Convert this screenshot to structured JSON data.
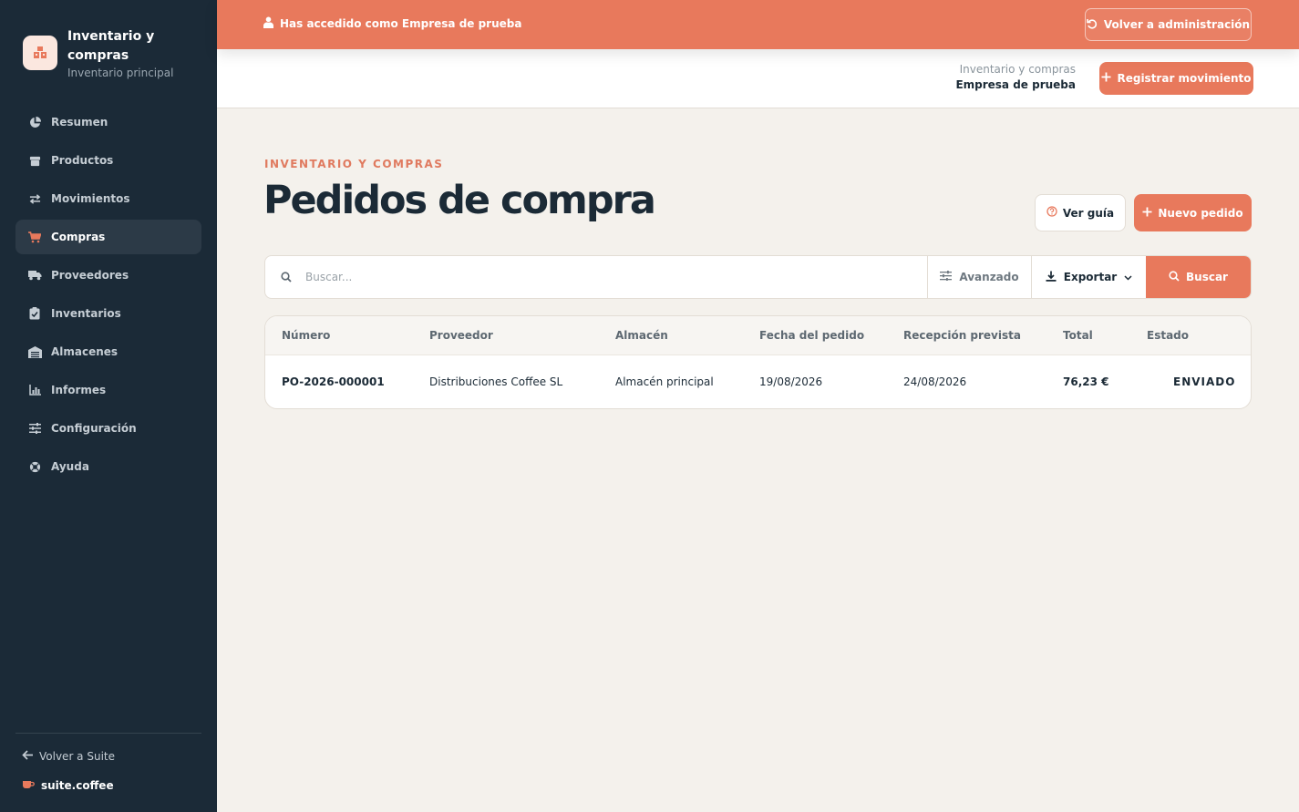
{
  "sidebar": {
    "app_title": "Inventario y compras",
    "app_subtitle": "Inventario principal",
    "items": [
      {
        "label": "Resumen",
        "icon": "pie-chart-icon"
      },
      {
        "label": "Productos",
        "icon": "box-icon"
      },
      {
        "label": "Movimientos",
        "icon": "arrows-exchange-icon"
      },
      {
        "label": "Compras",
        "icon": "cart-icon",
        "active": true
      },
      {
        "label": "Proveedores",
        "icon": "truck-icon"
      },
      {
        "label": "Inventarios",
        "icon": "clipboard-check-icon"
      },
      {
        "label": "Almacenes",
        "icon": "warehouse-icon"
      },
      {
        "label": "Informes",
        "icon": "bar-chart-icon"
      },
      {
        "label": "Configuración",
        "icon": "sliders-icon"
      },
      {
        "label": "Ayuda",
        "icon": "lifebuoy-icon"
      }
    ],
    "back_label": "Volver a Suite",
    "suite_brand": "suite.coffee"
  },
  "banner": {
    "message": "Has accedido como Empresa de prueba",
    "button_label": "Volver a administración"
  },
  "header": {
    "breadcrumb_top": "Inventario y compras",
    "breadcrumb_bottom": "Empresa de prueba",
    "register_label": "Registrar movimiento"
  },
  "page": {
    "eyebrow": "INVENTARIO Y COMPRAS",
    "title": "Pedidos de compra",
    "guide_label": "Ver guía",
    "new_label": "Nuevo pedido"
  },
  "search": {
    "placeholder": "Buscar...",
    "value": "",
    "advanced_label": "Avanzado",
    "export_label": "Exportar",
    "search_label": "Buscar"
  },
  "table": {
    "columns": [
      "Número",
      "Proveedor",
      "Almacén",
      "Fecha del pedido",
      "Recepción prevista",
      "Total",
      "Estado"
    ],
    "rows": [
      {
        "numero": "PO-2026-000001",
        "proveedor": "Distribuciones Coffee SL",
        "almacen": "Almacén principal",
        "fecha": "19/08/2026",
        "recepcion": "24/08/2026",
        "total": "76,23 €",
        "estado": "ENVIADO"
      }
    ]
  },
  "colors": {
    "accent": "#e8795c",
    "sidebar_bg": "#1b2a37",
    "page_bg": "#f4f1ec"
  }
}
